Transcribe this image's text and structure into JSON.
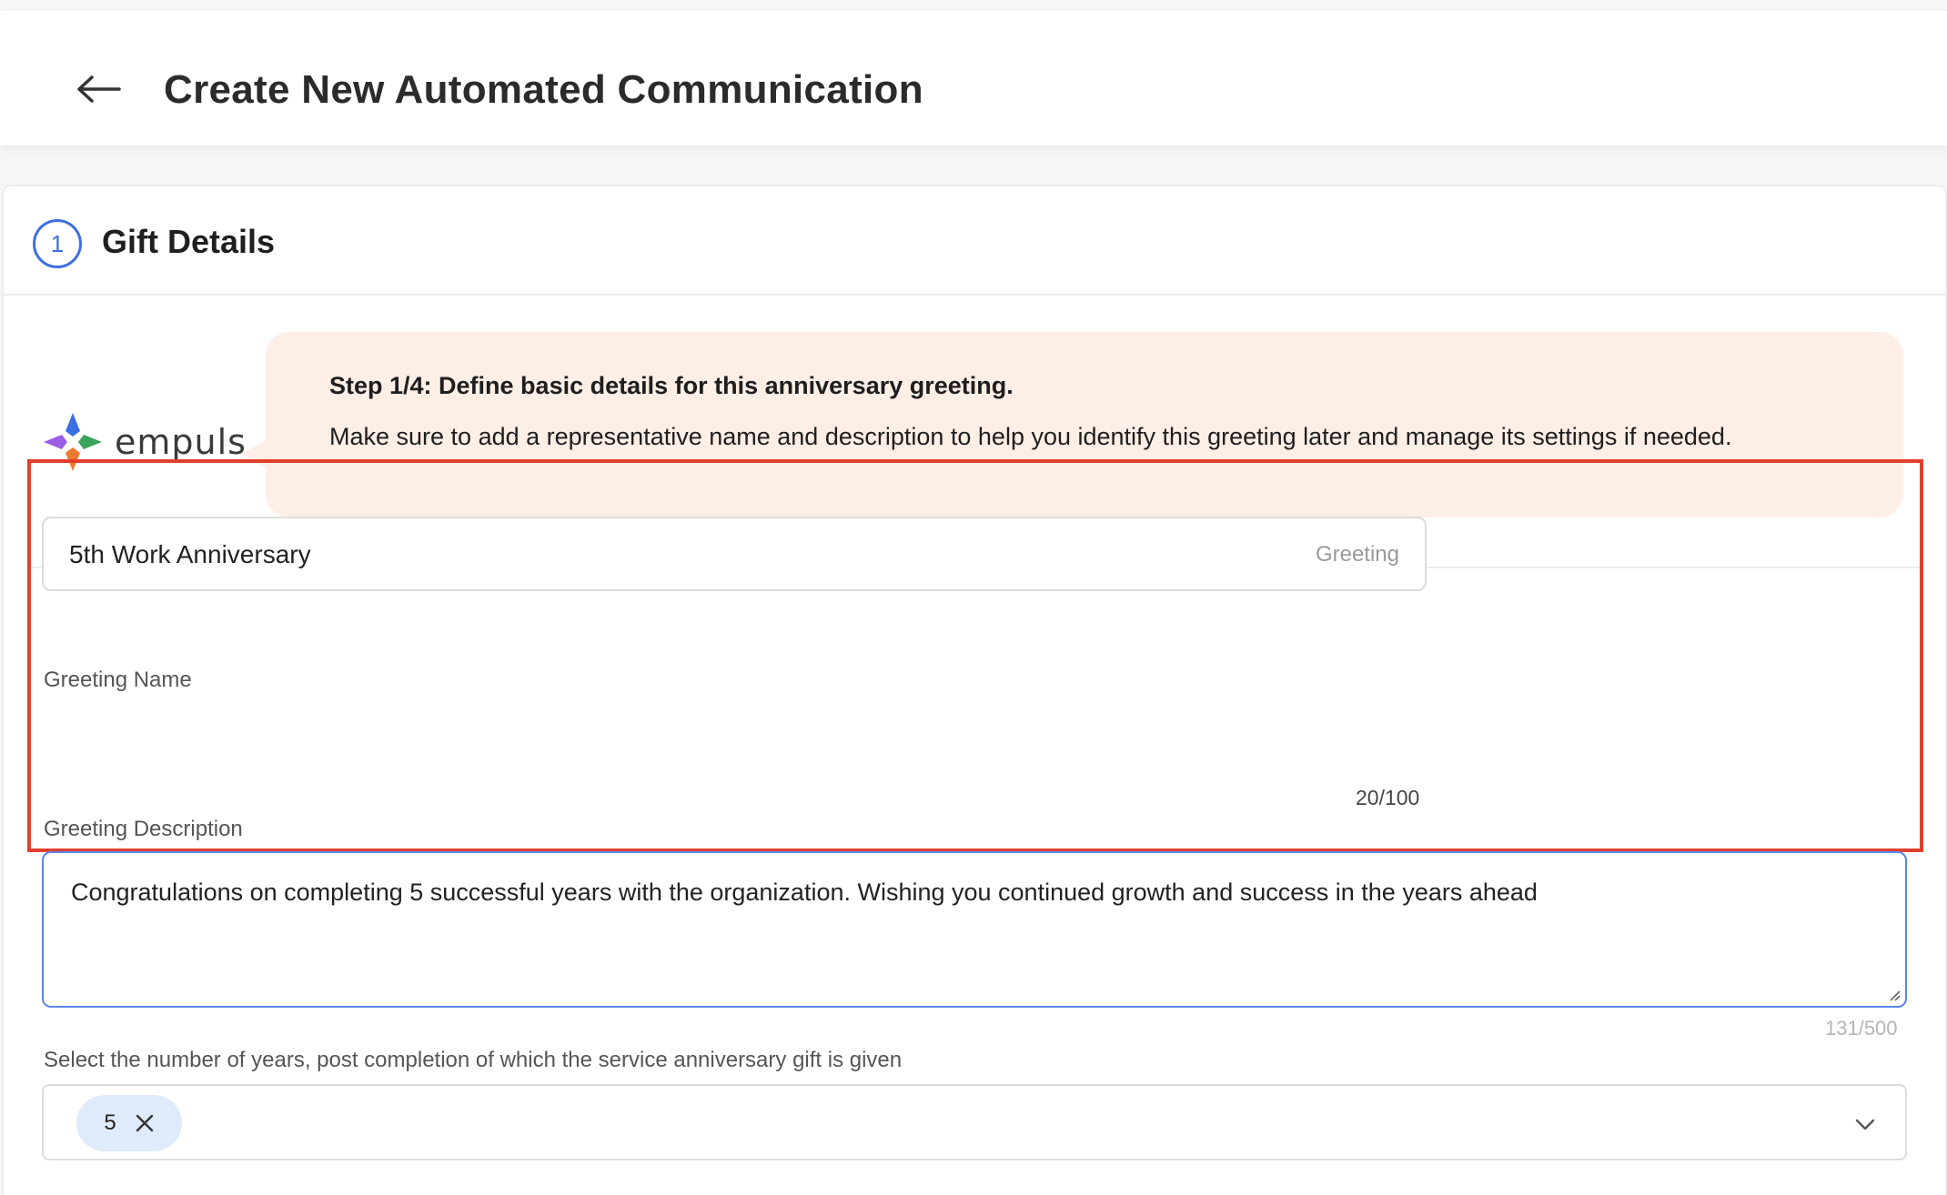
{
  "header": {
    "title": "Create New Automated Communication",
    "back_icon": "arrow-left-icon"
  },
  "step": {
    "number": "1",
    "title": "Gift Details"
  },
  "brand": {
    "logo_text": "empuls",
    "colors": {
      "blue": "#3b6fe3",
      "green": "#3aa35c",
      "orange": "#ee7a30",
      "purple": "#9b5de5"
    }
  },
  "info_bubble": {
    "title": "Step 1/4: Define basic details for this anniversary greeting.",
    "body": "Make sure to add a representative name and description to help you identify this greeting later and manage its settings if needed."
  },
  "greeting_name": {
    "label": "Greeting Name",
    "value": "5th Work Anniversary",
    "suffix": "Greeting",
    "counter": "20/100"
  },
  "greeting_description": {
    "label": "Greeting Description",
    "value": "Congratulations on completing 5 successful years with the organization. Wishing you continued growth and success in the years ahead",
    "counter": "131/500"
  },
  "years_select": {
    "label": "Select the number of years, post completion of which the service anniversary gift is given",
    "chips": [
      "5"
    ]
  },
  "colors": {
    "accent": "#3d6fe0",
    "highlight": "#e0402c",
    "bubble_bg": "#fdeee6",
    "chip_bg": "#dfeafb"
  }
}
